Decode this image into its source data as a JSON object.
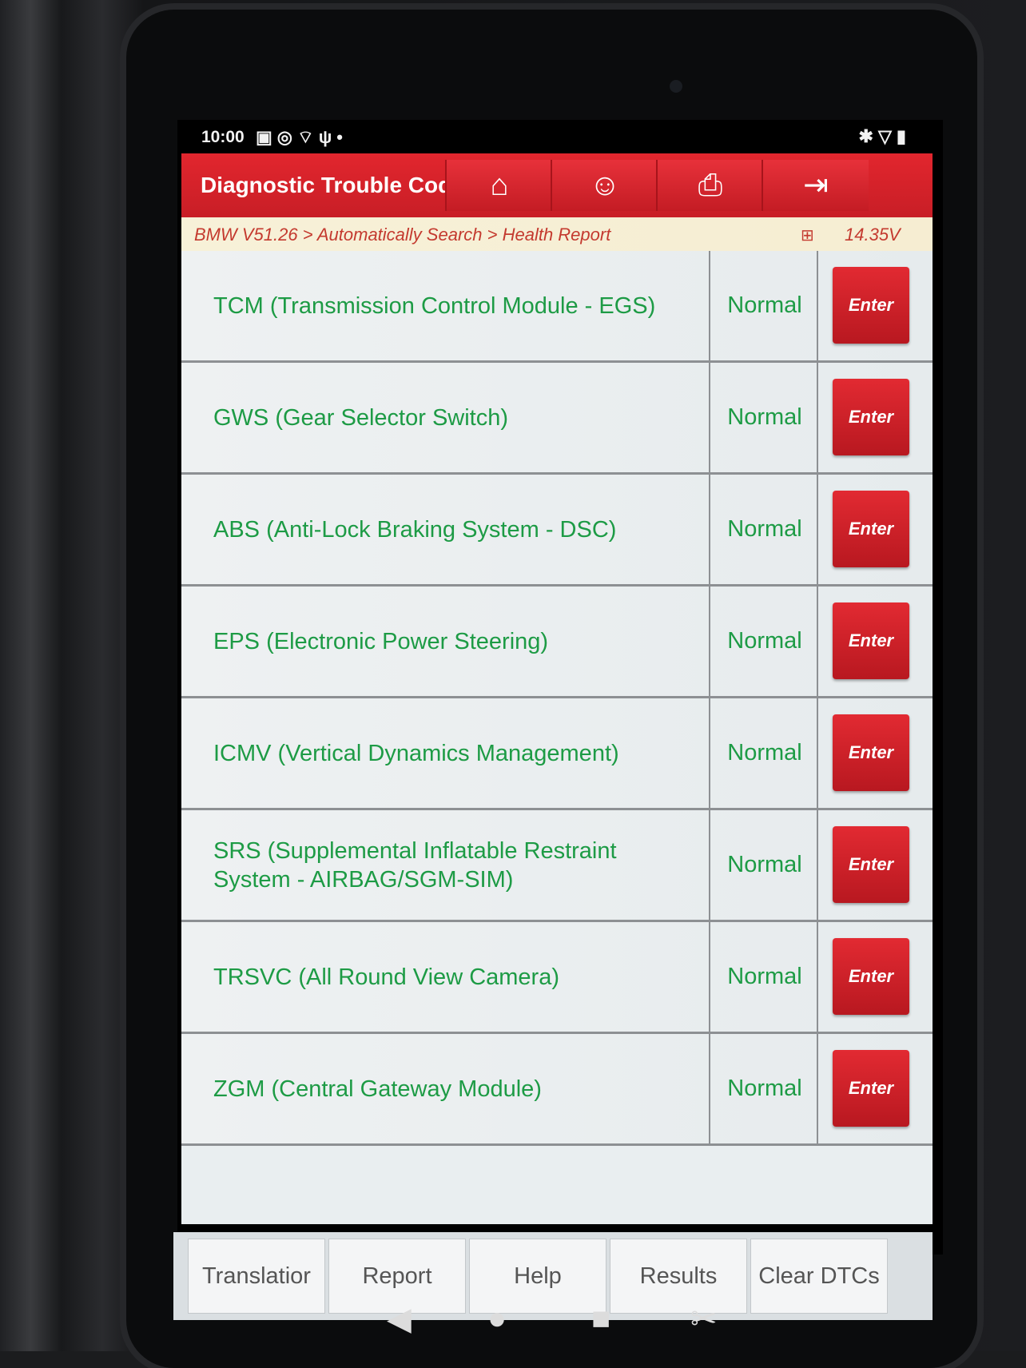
{
  "statusbar": {
    "time": "10:00",
    "left_icons": [
      "image-icon",
      "alarm-icon",
      "wifi-off-icon",
      "usb-icon",
      "dot-icon"
    ],
    "right_icons": [
      "bluetooth-icon",
      "signal-icon",
      "battery-icon"
    ]
  },
  "titlebar": {
    "title": "Diagnostic Trouble Cod",
    "buttons": [
      "home-icon",
      "support-icon",
      "print-icon",
      "exit-icon"
    ]
  },
  "breadcrumb": {
    "path": "BMW V51.26 > Automatically Search > Health Report",
    "voltage": "14.35V"
  },
  "modules": [
    {
      "name": "TCM (Transmission Control Module - EGS)",
      "status": "Normal",
      "action": "Enter"
    },
    {
      "name": "GWS (Gear Selector Switch)",
      "status": "Normal",
      "action": "Enter"
    },
    {
      "name": "ABS (Anti-Lock Braking System - DSC)",
      "status": "Normal",
      "action": "Enter"
    },
    {
      "name": "EPS (Electronic Power Steering)",
      "status": "Normal",
      "action": "Enter"
    },
    {
      "name": "ICMV (Vertical Dynamics Management)",
      "status": "Normal",
      "action": "Enter"
    },
    {
      "name": "SRS (Supplemental Inflatable Restraint System - AIRBAG/SGM-SIM)",
      "status": "Normal",
      "action": "Enter"
    },
    {
      "name": "TRSVC (All Round View Camera)",
      "status": "Normal",
      "action": "Enter"
    },
    {
      "name": "ZGM (Central Gateway Module)",
      "status": "Normal",
      "action": "Enter"
    }
  ],
  "footer": {
    "buttons": [
      "Translatior",
      "Report",
      "Help",
      "Results",
      "Clear DTCs"
    ]
  },
  "navbar": [
    "back-icon",
    "home-circle-icon",
    "recents-icon",
    "screenshot-icon"
  ],
  "colors": {
    "accent_red": "#d3222a",
    "status_green": "#1d9b45",
    "crumb_red": "#c43a2f"
  }
}
